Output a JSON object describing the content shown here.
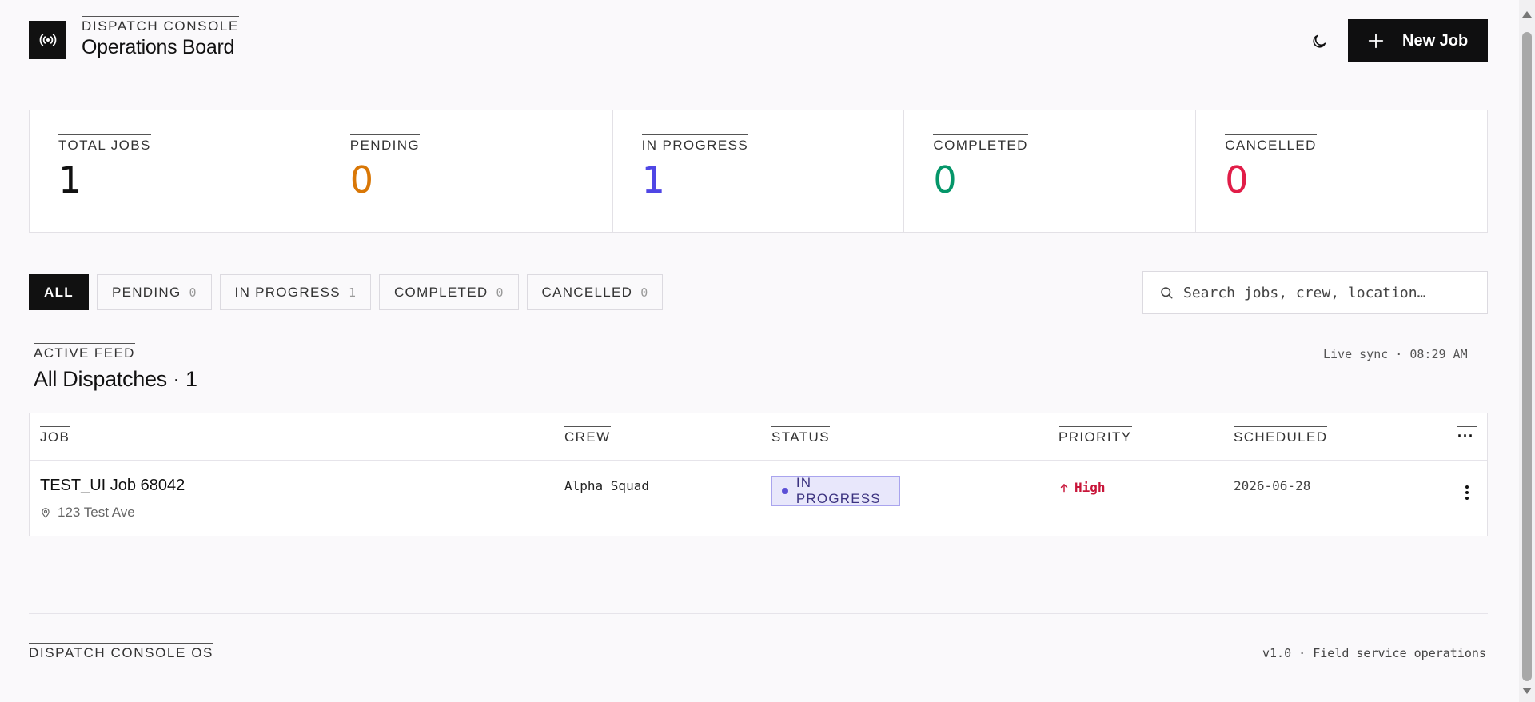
{
  "header": {
    "subtitle": "DISPATCH CONSOLE",
    "title": "Operations Board",
    "new_job_label": "New Job"
  },
  "stats": [
    {
      "label": "TOTAL JOBS",
      "value": "1",
      "color": "#111111"
    },
    {
      "label": "PENDING",
      "value": "0",
      "color": "#d97706"
    },
    {
      "label": "IN PROGRESS",
      "value": "1",
      "color": "#4f46e5"
    },
    {
      "label": "COMPLETED",
      "value": "0",
      "color": "#059669"
    },
    {
      "label": "CANCELLED",
      "value": "0",
      "color": "#e11d48"
    }
  ],
  "filters": [
    {
      "label": "ALL",
      "count": "",
      "active": true
    },
    {
      "label": "PENDING",
      "count": "0",
      "active": false
    },
    {
      "label": "IN PROGRESS",
      "count": "1",
      "active": false
    },
    {
      "label": "COMPLETED",
      "count": "0",
      "active": false
    },
    {
      "label": "CANCELLED",
      "count": "0",
      "active": false
    }
  ],
  "search": {
    "placeholder": "Search jobs, crew, location…"
  },
  "feed": {
    "subtitle": "ACTIVE FEED",
    "title": "All Dispatches · 1",
    "live_sync": "Live sync · 08:29 AM"
  },
  "table": {
    "columns": [
      "JOB",
      "CREW",
      "STATUS",
      "PRIORITY",
      "SCHEDULED"
    ],
    "rows": [
      {
        "job": "TEST_UI Job 68042",
        "location": "123 Test Ave",
        "crew": "Alpha Squad",
        "status": "IN PROGRESS",
        "priority": "High",
        "scheduled": "2026-06-28"
      }
    ]
  },
  "footer": {
    "brand": "DISPATCH CONSOLE OS",
    "version": "v1.0 · Field service operations"
  },
  "icons": {
    "logo": "broadcast-icon",
    "theme": "moon-icon",
    "add": "plus-icon",
    "search": "search-icon",
    "location": "map-pin-icon",
    "priority": "arrow-up-icon",
    "menu": "more-vertical-icon"
  }
}
